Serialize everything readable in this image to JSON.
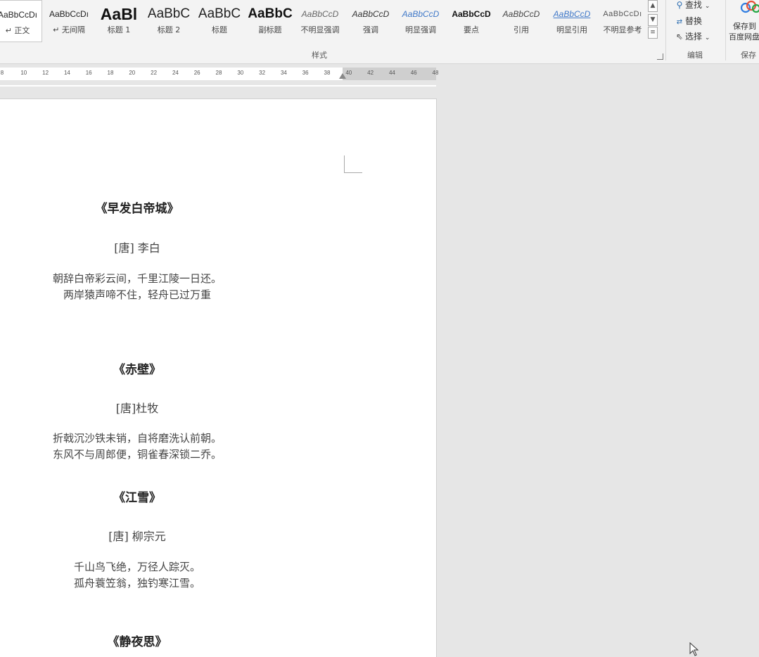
{
  "ribbon": {
    "styles": [
      {
        "preview": "AaBbCcDı",
        "name": "↵ 正文",
        "selected": true
      },
      {
        "preview": "AaBbCcDı",
        "name": "↵ 无间隔"
      },
      {
        "preview": "AaBl",
        "name": "标题 1"
      },
      {
        "preview": "AaBbC",
        "name": "标题 2"
      },
      {
        "preview": "AaBbC",
        "name": "标题"
      },
      {
        "preview": "AaBbC",
        "name": "副标题"
      },
      {
        "preview": "AaBbCcD",
        "name": "不明显强调"
      },
      {
        "preview": "AaBbCcD",
        "name": "强调"
      },
      {
        "preview": "AaBbCcD",
        "name": "明显强调"
      },
      {
        "preview": "AaBbCcD",
        "name": "要点"
      },
      {
        "preview": "AaBbCcD",
        "name": "引用"
      },
      {
        "preview": "AaBbCcD",
        "name": "明显引用"
      },
      {
        "preview": "AaBbCcDı",
        "name": "不明显参考"
      }
    ],
    "styles_group_label": "样式",
    "editing": {
      "find": "查找",
      "replace": "替换",
      "select": "选择",
      "group_label": "编辑"
    },
    "save": {
      "label_line1": "保存到",
      "label_line2": "百度网盘",
      "group_label": "保存"
    }
  },
  "ruler": {
    "ticks": [
      "8",
      "10",
      "12",
      "14",
      "16",
      "18",
      "20",
      "22",
      "24",
      "26",
      "28",
      "30",
      "32",
      "34",
      "36",
      "38",
      "40",
      "42",
      "44",
      "46",
      "48"
    ]
  },
  "document": {
    "poems": [
      {
        "title": "《早发白帝城》",
        "author": "[唐] 李白",
        "lines": [
          "朝辞白帝彩云间，千里江陵一日还。",
          "两岸猿声啼不住，轻舟已过万重"
        ]
      },
      {
        "title": "《赤壁》",
        "author": "[唐]杜牧",
        "lines": [
          "折戟沉沙铁未销，自将磨洗认前朝。",
          "东风不与周郎便，铜雀春深锁二乔。"
        ]
      },
      {
        "title": "《江雪》",
        "author": "[唐] 柳宗元",
        "lines": [
          "千山鸟飞绝，万径人踪灭。",
          "孤舟蓑笠翁，独钓寒江雪。"
        ]
      },
      {
        "title": "《静夜思》"
      }
    ]
  }
}
